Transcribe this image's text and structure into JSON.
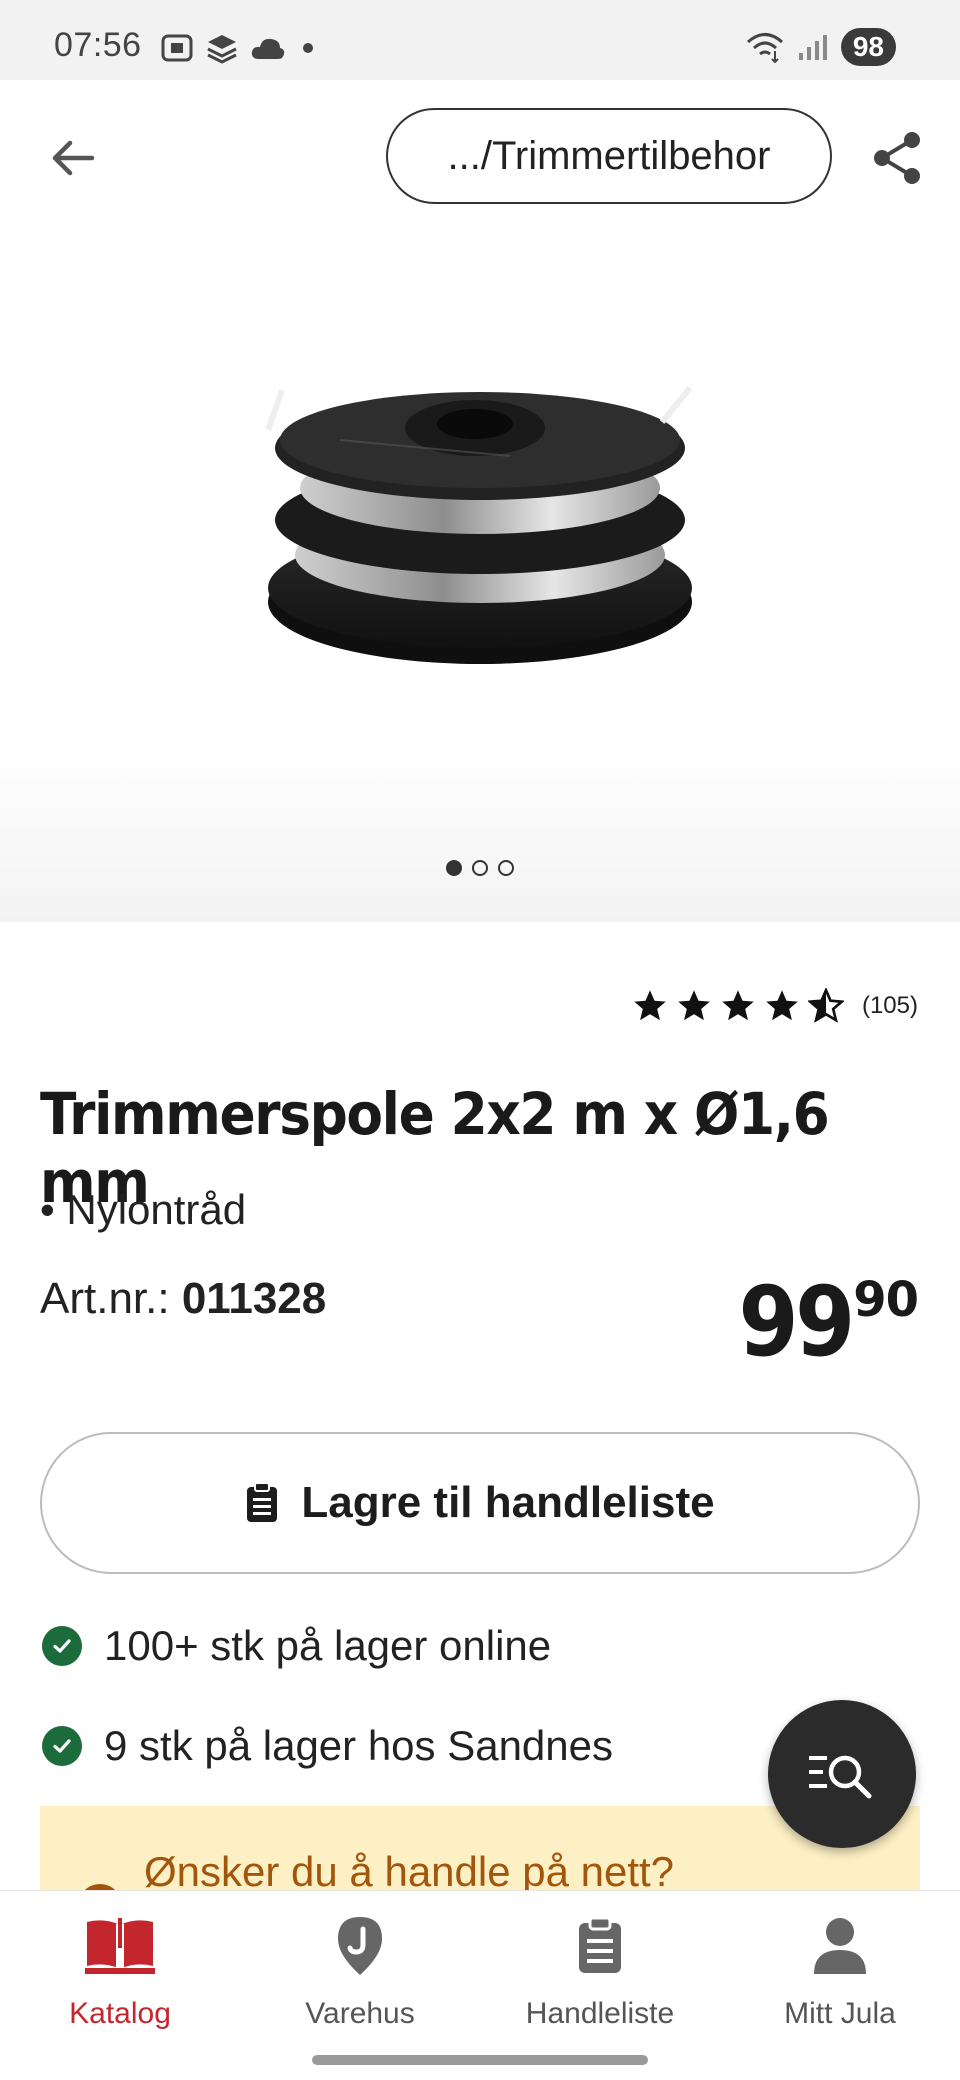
{
  "status_bar": {
    "time": "07:56",
    "battery": "98",
    "icons_left": [
      "screenshot-icon",
      "layers-icon",
      "cloud-icon",
      "dot-icon"
    ],
    "icons_right": [
      "wifi-icon",
      "signal-icon"
    ]
  },
  "header": {
    "breadcrumb": ".../Trimmertilbehor",
    "back_icon": "arrow-left-icon",
    "share_icon": "share-icon"
  },
  "gallery": {
    "image_count": 3,
    "active_index": 0
  },
  "product": {
    "rating_value": 4.5,
    "rating_max": 5,
    "review_count": "(105)",
    "title": "Trimmerspole 2x2 m x Ø1,6 mm",
    "bullet": "• Nylontråd",
    "artnr_label": "Art.nr.: ",
    "artnr_value": "011328",
    "price_main": "99",
    "price_decimal": "90"
  },
  "actions": {
    "save_label": "Lagre til handleliste",
    "save_icon": "clipboard-icon"
  },
  "stock": {
    "online": "100+ stk på lager online",
    "store": "9 stk på lager hos Sandnes"
  },
  "banner": {
    "text": "Ønsker du å handle på nett?"
  },
  "fab": {
    "icon": "search-list-icon"
  },
  "nav": {
    "items": [
      {
        "label": "Katalog",
        "icon": "book-icon",
        "active": true
      },
      {
        "label": "Varehus",
        "icon": "map-pin-icon",
        "active": false
      },
      {
        "label": "Handleliste",
        "icon": "clipboard-icon",
        "active": false
      },
      {
        "label": "Mitt Jula",
        "icon": "person-icon",
        "active": false
      }
    ]
  },
  "colors": {
    "brand_red": "#c4262e",
    "stock_green": "#1c6b3a",
    "banner_bg": "#fdf0c4",
    "banner_text": "#a3560b"
  }
}
